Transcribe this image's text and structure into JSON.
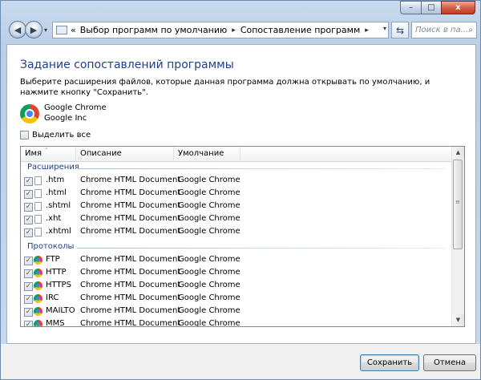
{
  "window": {
    "caption_buttons": {
      "minimize": "–",
      "maximize": "□",
      "close": "x"
    }
  },
  "nav": {
    "back_glyph": "◀",
    "forward_glyph": "▶",
    "history_glyph": "▾",
    "breadcrumb_prefix": "«",
    "breadcrumb": [
      "Выбор программ по умолчанию",
      "Сопоставление программ"
    ],
    "breadcrumb_sep": "▸",
    "address_dropdown": "▾",
    "refresh_glyph": "⇆",
    "search_placeholder": "Поиск в па...",
    "search_icon": "⌕"
  },
  "page": {
    "heading": "Задание сопоставлений программы",
    "instruction": "Выберите расширения файлов, которые данная программа должна открывать по умолчанию, и нажмите кнопку \"Сохранить\".",
    "program_name": "Google Chrome",
    "program_vendor": "Google Inc",
    "select_all": "Выделить все"
  },
  "list": {
    "columns": [
      "Имя",
      "Описание",
      "Умолчание"
    ],
    "sort_glyph": "˄",
    "check_glyph": "✓",
    "groups": [
      {
        "title": "Расширения",
        "rows": [
          {
            "name": ".htm",
            "desc": "Chrome HTML Document",
            "def": "Google Chrome"
          },
          {
            "name": ".html",
            "desc": "Chrome HTML Document",
            "def": "Google Chrome"
          },
          {
            "name": ".shtml",
            "desc": "Chrome HTML Document",
            "def": "Google Chrome"
          },
          {
            "name": ".xht",
            "desc": "Chrome HTML Document",
            "def": "Google Chrome"
          },
          {
            "name": ".xhtml",
            "desc": "Chrome HTML Document",
            "def": "Google Chrome"
          }
        ]
      },
      {
        "title": "Протоколы",
        "rows": [
          {
            "name": "FTP",
            "desc": "Chrome HTML Document",
            "def": "Google Chrome"
          },
          {
            "name": "HTTP",
            "desc": "Chrome HTML Document",
            "def": "Google Chrome"
          },
          {
            "name": "HTTPS",
            "desc": "Chrome HTML Document",
            "def": "Google Chrome"
          },
          {
            "name": "IRC",
            "desc": "Chrome HTML Document",
            "def": "Google Chrome"
          },
          {
            "name": "MAILTO",
            "desc": "Chrome HTML Document",
            "def": "Google Chrome"
          },
          {
            "name": "MMS",
            "desc": "Chrome HTML Document",
            "def": "Google Chrome"
          }
        ]
      }
    ],
    "scroll_up": "▲",
    "scroll_down": "▼",
    "thumb_grip": "≡"
  },
  "footer": {
    "save": "Сохранить",
    "cancel": "Отмена"
  },
  "colors": {
    "heading": "#1e3f87",
    "group": "#1e3f87",
    "window_frame": "#b9cfe6",
    "close_button": "#c23a22"
  }
}
